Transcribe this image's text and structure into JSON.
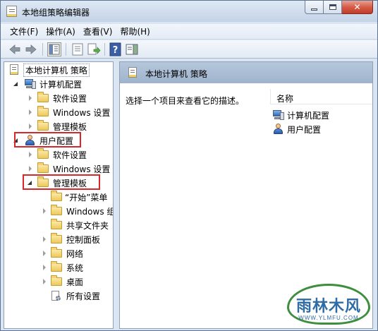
{
  "window": {
    "title": "本地组策略编辑器"
  },
  "menu": [
    "文件(F)",
    "操作(A)",
    "查看(V)",
    "帮助(H)"
  ],
  "toolbar": {
    "buttons": [
      "back-icon",
      "forward-icon",
      "show-hide-tree-icon",
      "properties-icon",
      "export-list-icon",
      "help-icon",
      "show-hide-action-pane-icon"
    ]
  },
  "tree": {
    "root": "本地计算机 策略",
    "computer_config": {
      "label": "计算机配置",
      "children": [
        "软件设置",
        "Windows 设置",
        "管理模板"
      ]
    },
    "user_config": {
      "label": "用户配置",
      "children": [
        "软件设置",
        "Windows 设置"
      ],
      "admin_templates": {
        "label": "管理模板",
        "children": [
          "“开始”菜单",
          "Windows 组件",
          "共享文件夹",
          "控制面板",
          "网络",
          "系统",
          "桌面",
          "所有设置"
        ]
      }
    }
  },
  "details": {
    "header_title": "本地计算机 策略",
    "description": "选择一个项目来查看它的描述。",
    "column_name": "名称",
    "items": [
      "计算机配置",
      "用户配置"
    ]
  },
  "watermark": {
    "text": "雨林木风",
    "url": "WWW.YLMFU.COM"
  },
  "colors": {
    "highlight_box": "#d8262a",
    "header_band": "#a9bcd4"
  }
}
